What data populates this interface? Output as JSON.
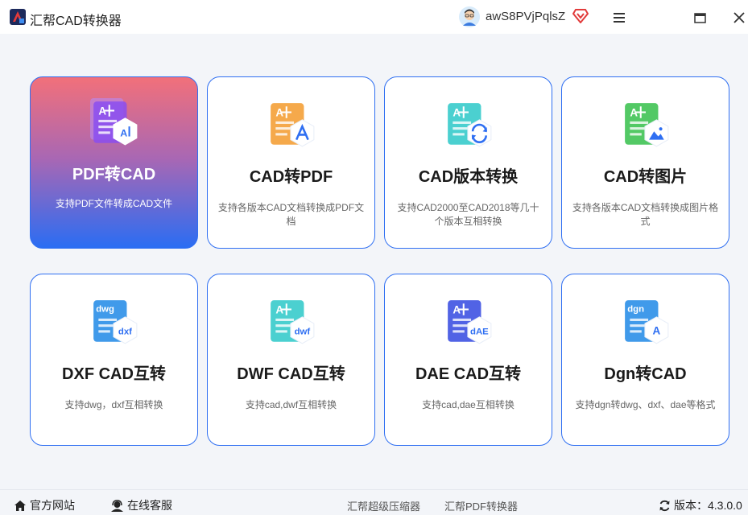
{
  "window": {
    "title": "汇帮CAD转换器",
    "username": "awS8PVjPqlsZ"
  },
  "cards": [
    {
      "title": "PDF转CAD",
      "desc": "支持PDF文件转成CAD文件",
      "active": true,
      "icon": "pdf-to-cad-icon",
      "badge": "A+",
      "color": "#8a4df0"
    },
    {
      "title": "CAD转PDF",
      "desc": "支持各版本CAD文档转换成PDF文档",
      "icon": "cad-to-pdf-icon",
      "badge": "A+",
      "color": "#f39a2c"
    },
    {
      "title": "CAD版本转换",
      "desc": "支持CAD2000至CAD2018等几十个版本互相转换",
      "icon": "cad-version-convert-icon",
      "badge": "A+",
      "color": "#2cc8c8"
    },
    {
      "title": "CAD转图片",
      "desc": "支持各版本CAD文档转换成图片格式",
      "icon": "cad-to-image-icon",
      "badge": "A+",
      "color": "#35c04a"
    },
    {
      "title": "DXF CAD互转",
      "desc": "支持dwg，dxf互相转换",
      "icon": "dxf-convert-icon",
      "badge": "dwg",
      "label": "dxf",
      "color": "#1f88e6"
    },
    {
      "title": "DWF CAD互转",
      "desc": "支持cad,dwf互相转换",
      "icon": "dwf-convert-icon",
      "badge": "A+",
      "label": "dwf",
      "color": "#2cc8c8"
    },
    {
      "title": "DAE CAD互转",
      "desc": "支持cad,dae互相转换",
      "icon": "dae-convert-icon",
      "badge": "A+",
      "label": "dAE",
      "color": "#3348e0"
    },
    {
      "title": "Dgn转CAD",
      "desc": "支持dgn转dwg、dxf、dae等格式",
      "icon": "dgn-to-cad-icon",
      "badge": "dgn",
      "label": "A",
      "color": "#1f88e6"
    }
  ],
  "footer": {
    "website": "官方网站",
    "support": "在线客服",
    "link1": "汇帮超级压缩器",
    "link2": "汇帮PDF转换器",
    "version": "版本：4.3.0.0"
  },
  "colors": {
    "accent": "#2f6ff2",
    "active_gradient_top": "#f2707a",
    "active_gradient_bottom": "#2a6df3"
  }
}
